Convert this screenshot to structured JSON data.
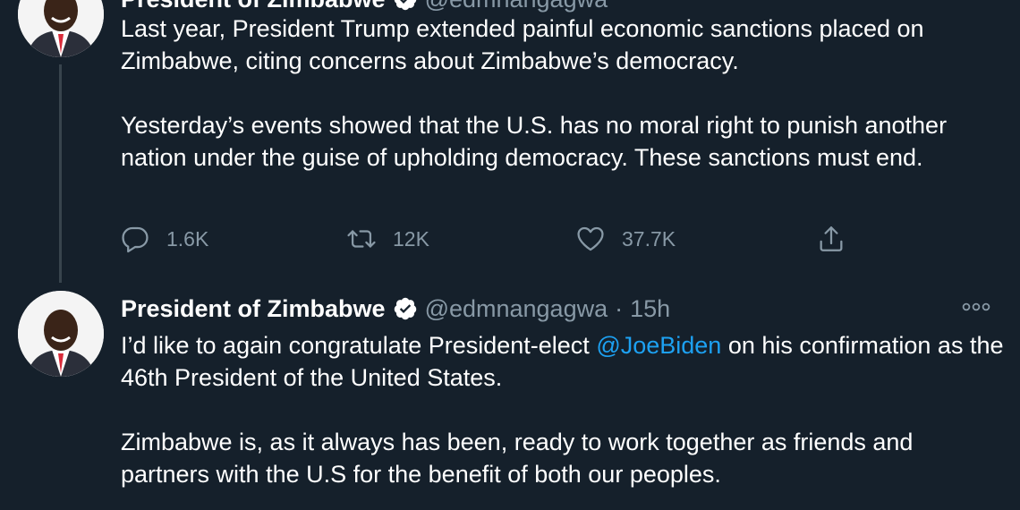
{
  "tweet_top": {
    "author_name": "President of Zimbabwe",
    "handle": "@edmnangagwa",
    "paragraphs": [
      "Last year, President Trump extended painful economic sanctions placed on Zimbabwe, citing concerns about Zimbabwe’s democracy.",
      "Yesterday’s events showed that the U.S. has no moral right to punish another nation under the guise of upholding democracy. These sanctions must end."
    ],
    "replies": "1.6K",
    "retweets": "12K",
    "likes": "37.7K"
  },
  "tweet_bottom": {
    "author_name": "President of Zimbabwe",
    "handle": "@edmnangagwa",
    "separator": "·",
    "time": "15h",
    "text_before_mention": "I’d like to again congratulate President-elect ",
    "mention": "@JoeBiden",
    "text_after_mention": " on his confirmation as the 46th President of the United States.",
    "paragraph2": "Zimbabwe is, as it always has been, ready to work together as friends and partners with the U.S for the benefit of both our peoples."
  },
  "colors": {
    "background": "#15202b",
    "text": "#ffffff",
    "secondary": "#8899a6",
    "link": "#1da1f2",
    "thread_line": "#38444d"
  },
  "icons": {
    "reply": "reply-icon",
    "retweet": "retweet-icon",
    "like": "like-icon",
    "share": "share-icon",
    "verified": "verified-badge-icon",
    "more": "more-options-icon"
  }
}
